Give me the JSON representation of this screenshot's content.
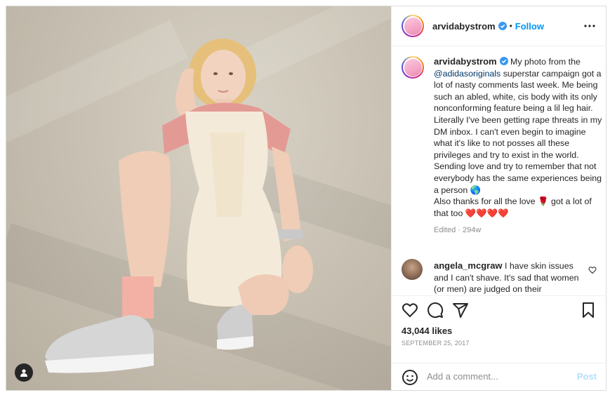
{
  "post": {
    "username": "arvidabystrom",
    "follow_label": "Follow",
    "dot": "•",
    "caption": {
      "before_mention": "My photo from the ",
      "mention": "@adidasoriginals",
      "after_mention": " superstar campaign got a lot of nasty comments last week. Me being such an abled, white, cis body with its only nonconforming feature being a lil leg hair. Literally I've been getting rape threats in my DM inbox. I can't even begin to imagine what it's like to not posses all these privileges and try to exist in the world. Sending love and try to remember that not everybody has the same experiences being a person",
      "globe_emoji": "🌎",
      "line2_start": "Also thanks for all the love ",
      "rose_emoji": "🌹",
      "line2_end": " got a lot of that too ",
      "hearts": "❤️❤️❤️❤️"
    },
    "edited": "Edited · 294w"
  },
  "comment": {
    "username": "angela_mcgraw",
    "text": " I have skin issues and I can't shave. It's sad that women (or men) are judged on their"
  },
  "likes": "43,044 likes",
  "date": "September 25, 2017",
  "add_comment": {
    "placeholder": "Add a comment...",
    "post_label": "Post"
  },
  "colors": {
    "accent": "#0095f6",
    "verified": "#3897f0",
    "post_disabled": "#b2dffc",
    "muted": "#8e8e8e"
  },
  "icons": [
    "more-options-icon",
    "verified-icon",
    "heart-icon",
    "comment-icon",
    "share-icon",
    "bookmark-icon",
    "emoji-icon",
    "user-tag-icon"
  ]
}
